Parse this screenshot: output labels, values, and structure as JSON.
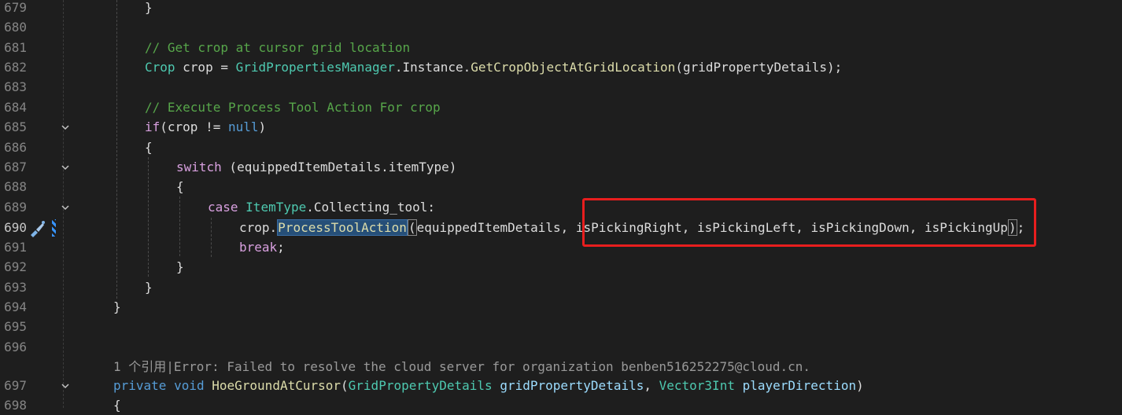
{
  "lines": [
    {
      "num": "679",
      "fold": "",
      "tokens": [
        {
          "t": "}",
          "c": ""
        }
      ]
    },
    {
      "num": "680",
      "fold": "",
      "tokens": []
    },
    {
      "num": "681",
      "fold": "",
      "tokens": [
        {
          "t": "// Get crop at cursor grid location",
          "c": "cm"
        }
      ]
    },
    {
      "num": "682",
      "fold": "",
      "tokens": [
        {
          "t": "Crop",
          "c": "ty"
        },
        {
          "t": " crop = ",
          "c": ""
        },
        {
          "t": "GridPropertiesManager",
          "c": "ty"
        },
        {
          "t": ".Instance.",
          "c": ""
        },
        {
          "t": "GetCropObjectAtGridLocation",
          "c": "fn"
        },
        {
          "t": "(gridPropertyDetails);",
          "c": ""
        }
      ]
    },
    {
      "num": "683",
      "fold": "",
      "tokens": []
    },
    {
      "num": "684",
      "fold": "",
      "tokens": [
        {
          "t": "// Execute Process Tool Action For crop",
          "c": "cm"
        }
      ]
    },
    {
      "num": "685",
      "fold": "v",
      "tokens": [
        {
          "t": "if",
          "c": "kw2"
        },
        {
          "t": "(crop != ",
          "c": ""
        },
        {
          "t": "null",
          "c": "kw"
        },
        {
          "t": ")",
          "c": ""
        }
      ]
    },
    {
      "num": "686",
      "fold": "",
      "tokens": [
        {
          "t": "{",
          "c": ""
        }
      ]
    },
    {
      "num": "687",
      "fold": "v",
      "tokens": [
        {
          "t": "switch",
          "c": "kw2"
        },
        {
          "t": " (equippedItemDetails.itemType)",
          "c": ""
        }
      ]
    },
    {
      "num": "688",
      "fold": "",
      "tokens": [
        {
          "t": "{",
          "c": ""
        }
      ]
    },
    {
      "num": "689",
      "fold": "v",
      "tokens": [
        {
          "t": "case",
          "c": "kw2"
        },
        {
          "t": " ",
          "c": ""
        },
        {
          "t": "ItemType",
          "c": "ty"
        },
        {
          "t": ".Collecting_tool:",
          "c": ""
        }
      ]
    },
    {
      "num": "690",
      "fold": "",
      "tokens": [
        {
          "t": "crop.",
          "c": ""
        },
        {
          "t": "ProcessToolAction",
          "c": "fn hl-sym"
        },
        {
          "t": "(",
          "c": "hl-brace"
        },
        {
          "t": "equippedItemDetails, isPickingRight, isPickingLeft, isPickingDown, isPickingUp",
          "c": ""
        },
        {
          "t": ")",
          "c": "hl-brace"
        },
        {
          "t": ";",
          "c": ""
        }
      ]
    },
    {
      "num": "691",
      "fold": "",
      "tokens": [
        {
          "t": "break",
          "c": "kw2"
        },
        {
          "t": ";",
          "c": ""
        }
      ]
    },
    {
      "num": "692",
      "fold": "",
      "tokens": [
        {
          "t": "}",
          "c": ""
        }
      ]
    },
    {
      "num": "693",
      "fold": "",
      "tokens": [
        {
          "t": "}",
          "c": ""
        }
      ]
    },
    {
      "num": "694",
      "fold": "",
      "tokens": [
        {
          "t": "}",
          "c": ""
        }
      ]
    },
    {
      "num": "695",
      "fold": "",
      "tokens": []
    },
    {
      "num": "696",
      "fold": "",
      "tokens": []
    },
    {
      "num": "",
      "fold": "",
      "tokens": [
        {
          "t": "1 个引用|Error: Failed to resolve the cloud server for organization benben516252275@cloud.cn.",
          "c": "hint"
        }
      ]
    },
    {
      "num": "697",
      "fold": "v",
      "tokens": [
        {
          "t": "private",
          "c": "kw"
        },
        {
          "t": " ",
          "c": ""
        },
        {
          "t": "void",
          "c": "kw"
        },
        {
          "t": " ",
          "c": ""
        },
        {
          "t": "HoeGroundAtCursor",
          "c": "fn"
        },
        {
          "t": "(",
          "c": ""
        },
        {
          "t": "GridPropertyDetails",
          "c": "ty"
        },
        {
          "t": " ",
          "c": ""
        },
        {
          "t": "gridPropertyDetails",
          "c": "pm"
        },
        {
          "t": ", ",
          "c": ""
        },
        {
          "t": "Vector3Int",
          "c": "ty"
        },
        {
          "t": " ",
          "c": ""
        },
        {
          "t": "playerDirection",
          "c": "pm"
        },
        {
          "t": ")",
          "c": ""
        }
      ]
    },
    {
      "num": "698",
      "fold": "",
      "tokens": [
        {
          "t": "{",
          "c": ""
        }
      ]
    }
  ],
  "icons": {
    "brush": "quick-actions-brush-icon",
    "fold": "chevron-down-icon"
  }
}
